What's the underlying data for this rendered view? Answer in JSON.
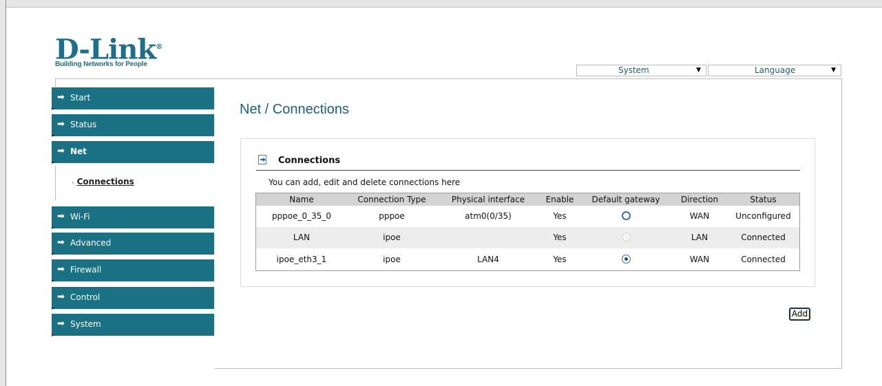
{
  "logo": {
    "word": "D-Link",
    "registered": "®",
    "tagline": "Building Networks for People"
  },
  "top_selects": {
    "system": "System",
    "language": "Language",
    "arrow": "▼"
  },
  "sidebar": {
    "arrow_glyph": "➡",
    "items": [
      {
        "label": "Start"
      },
      {
        "label": "Status"
      },
      {
        "label": "Net"
      },
      {
        "label": "Wi-Fi"
      },
      {
        "label": "Advanced"
      },
      {
        "label": "Firewall"
      },
      {
        "label": "Control"
      },
      {
        "label": "System"
      }
    ],
    "subitem": {
      "bullet": "›",
      "label": "Connections"
    }
  },
  "page": {
    "title": "Net / Connections"
  },
  "section": {
    "title": "Connections",
    "description": "You can add, edit and delete connections here"
  },
  "table": {
    "headers": [
      "Name",
      "Connection Type",
      "Physical interface",
      "Enable",
      "Default gateway",
      "Direction",
      "Status"
    ],
    "rows": [
      {
        "name": "pppoe_0_35_0",
        "type": "pppoe",
        "physical": "atm0(0/35)",
        "enable": "Yes",
        "gateway": "unchecked",
        "direction": "WAN",
        "status": "Unconfigured"
      },
      {
        "name": "LAN",
        "type": "ipoe",
        "physical": "",
        "enable": "Yes",
        "gateway": "disabled",
        "direction": "LAN",
        "status": "Connected"
      },
      {
        "name": "ipoe_eth3_1",
        "type": "ipoe",
        "physical": "LAN4",
        "enable": "Yes",
        "gateway": "checked",
        "direction": "WAN",
        "status": "Connected"
      }
    ]
  },
  "actions": {
    "add_label": "Add"
  },
  "colors": {
    "menu_bg": "#1a7184",
    "title": "#1a5f78",
    "brand": "#1f6f8a"
  }
}
